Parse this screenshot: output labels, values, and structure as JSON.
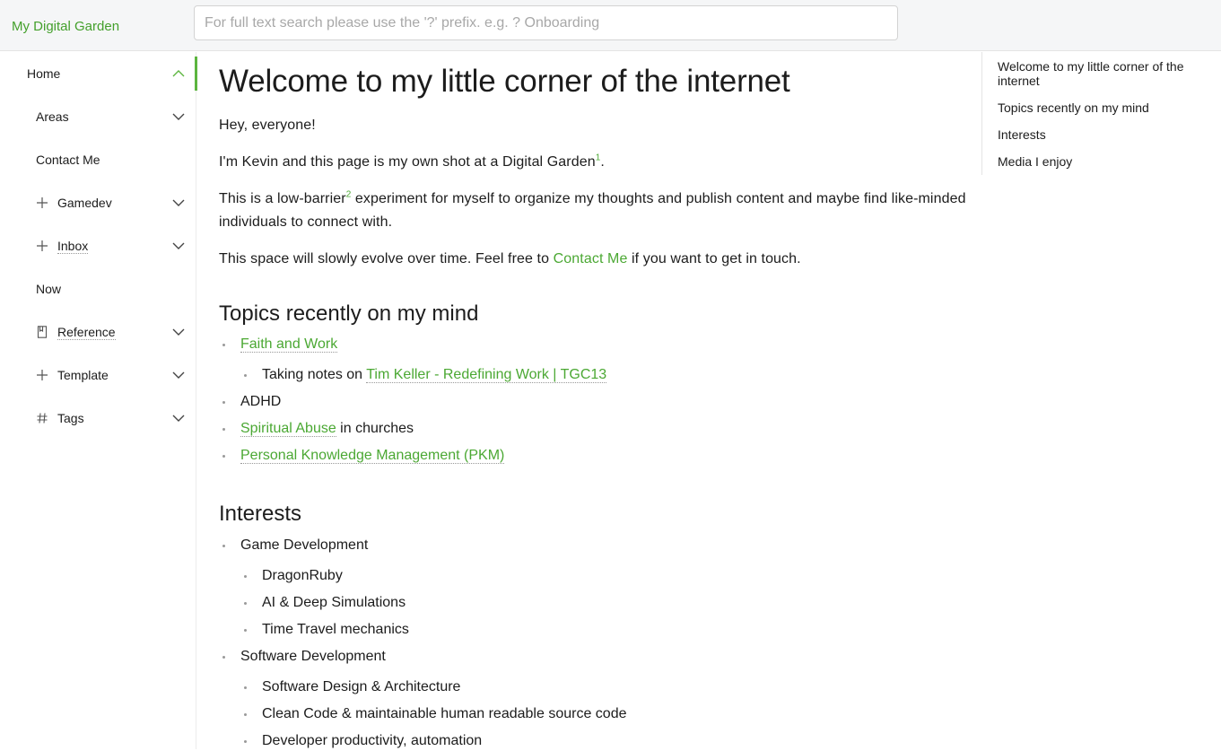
{
  "header": {
    "site_title": "My Digital Garden",
    "search_placeholder": "For full text search please use the '?' prefix. e.g. ? Onboarding"
  },
  "sidebar": {
    "items": [
      {
        "label": "Home"
      },
      {
        "label": "Areas"
      },
      {
        "label": "Contact Me"
      },
      {
        "label": "Gamedev"
      },
      {
        "label": "Inbox"
      },
      {
        "label": "Now"
      },
      {
        "label": "Reference"
      },
      {
        "label": "Template"
      },
      {
        "label": "Tags"
      }
    ]
  },
  "main": {
    "title": "Welcome to my little corner of the internet",
    "p1": "Hey, everyone!",
    "p2_text": "I'm Kevin and this page is my own shot at a Digital Garden",
    "p2_fn": "1",
    "p2_end": ".",
    "p3_a": "This is a low-barrier",
    "p3_fn": "2",
    "p3_b": " experiment for myself to organize my thoughts and publish content and maybe find like-minded individuals to connect with.",
    "p4_a": "This space will slowly evolve over time. Feel free to ",
    "p4_link": "Contact Me",
    "p4_b": " if you want to get in touch.",
    "topics_heading": "Topics recently on my mind",
    "topics": {
      "faith_link": "Faith and Work",
      "notes_prefix": "Taking notes on ",
      "notes_link": "Tim Keller - Redefining Work | TGC13",
      "adhd": "ADHD",
      "abuse_link": "Spiritual Abuse",
      "abuse_suffix": " in churches",
      "pkm_link": "Personal Knowledge Management (PKM)"
    },
    "interests_heading": "Interests",
    "interests": {
      "gamedev": "Game Development",
      "dragonruby": "DragonRuby",
      "ai": "AI & Deep Simulations",
      "timetravel": "Time Travel mechanics",
      "softdev": "Software Development",
      "design": "Software Design & Architecture",
      "cleancode": "Clean Code & maintainable human readable source code",
      "productivity": "Developer productivity, automation"
    }
  },
  "toc": {
    "items": [
      "Welcome to my little corner of the internet",
      "Topics recently on my mind",
      "Interests",
      "Media I enjoy"
    ]
  },
  "colors": {
    "accent": "#4ba833",
    "header_bg": "#f5f6f7"
  },
  "icons": {
    "expand": "chevron-down-icon",
    "collapse": "chevron-up-icon",
    "folder": "plus-icon",
    "reference": "bookmark-icon",
    "tags": "hash-icon"
  }
}
